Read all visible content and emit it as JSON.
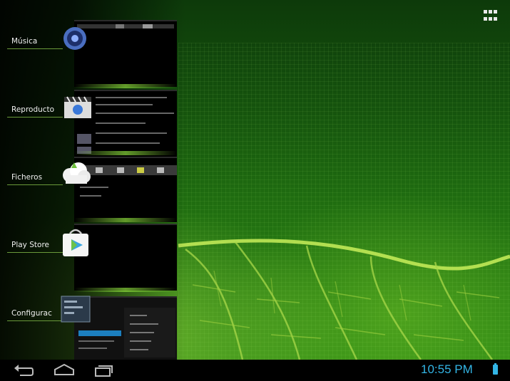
{
  "home_screen": {
    "apps_button_icon": "apps-grid-icon"
  },
  "recent_apps": [
    {
      "label": "Música",
      "icon": "music-speaker-icon"
    },
    {
      "label": "Reproducto",
      "icon": "video-clapperboard-icon"
    },
    {
      "label": "Ficheros",
      "icon": "files-cloud-icon"
    },
    {
      "label": "Play Store",
      "icon": "play-store-bag-icon"
    },
    {
      "label": "Configurac",
      "icon": "settings-icon"
    }
  ],
  "navigation_bar": {
    "back_icon": "back-icon",
    "home_icon": "home-icon",
    "recent_icon": "recent-apps-icon"
  },
  "status_bar": {
    "time": "10:55 PM",
    "battery_icon": "battery-icon",
    "accent_color": "#33b5e5"
  }
}
